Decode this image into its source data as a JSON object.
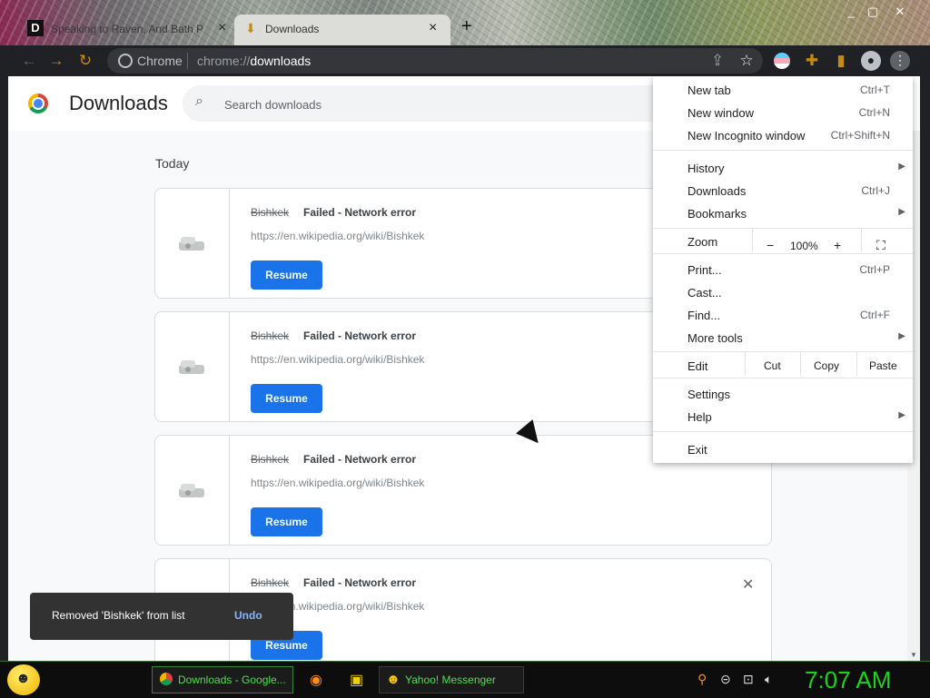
{
  "browser": {
    "tabs": [
      {
        "title": "Speaking to Raven, And Bath P",
        "favicon_letter": "D"
      },
      {
        "title": "Downloads"
      }
    ],
    "new_tab_symbol": "+",
    "window_controls": [
      "_",
      "▢",
      "✕"
    ],
    "omnibox": {
      "site_chip": "Chrome",
      "url_prefix": "chrome://",
      "url_highlight": "downloads"
    }
  },
  "page": {
    "title": "Downloads",
    "search_placeholder": "Search downloads",
    "section_label": "Today",
    "downloads": [
      {
        "name": "Bishkek",
        "status": "Failed - Network error",
        "url": "https://en.wikipedia.org/wiki/Bishkek",
        "button": "Resume"
      },
      {
        "name": "Bishkek",
        "status": "Failed - Network error",
        "url": "https://en.wikipedia.org/wiki/Bishkek",
        "button": "Resume"
      },
      {
        "name": "Bishkek",
        "status": "Failed - Network error",
        "url": "https://en.wikipedia.org/wiki/Bishkek",
        "button": "Resume"
      },
      {
        "name": "Bishkek",
        "status": "Failed - Network error",
        "url": "https://en.wikipedia.org/wiki/Bishkek",
        "button": "Resume"
      }
    ]
  },
  "toast": {
    "message": "Removed 'Bishkek' from list",
    "action": "Undo"
  },
  "menu": {
    "new_tab": {
      "label": "New tab",
      "shortcut": "Ctrl+T"
    },
    "new_window": {
      "label": "New window",
      "shortcut": "Ctrl+N"
    },
    "incognito": {
      "label": "New Incognito window",
      "shortcut": "Ctrl+Shift+N"
    },
    "history": {
      "label": "History"
    },
    "downloads": {
      "label": "Downloads",
      "shortcut": "Ctrl+J"
    },
    "bookmarks": {
      "label": "Bookmarks"
    },
    "zoom": {
      "label": "Zoom",
      "minus": "−",
      "value": "100%",
      "plus": "+"
    },
    "print": {
      "label": "Print...",
      "shortcut": "Ctrl+P"
    },
    "cast": {
      "label": "Cast..."
    },
    "find": {
      "label": "Find...",
      "shortcut": "Ctrl+F"
    },
    "more_tools": {
      "label": "More tools"
    },
    "edit": {
      "label": "Edit",
      "cut": "Cut",
      "copy": "Copy",
      "paste": "Paste"
    },
    "settings": {
      "label": "Settings"
    },
    "help": {
      "label": "Help"
    },
    "exit": {
      "label": "Exit"
    }
  },
  "taskbar": {
    "tasks": [
      {
        "label": "Downloads - Google..."
      },
      {
        "label": "Yahoo! Messenger"
      }
    ],
    "clock": "7:07 AM"
  }
}
